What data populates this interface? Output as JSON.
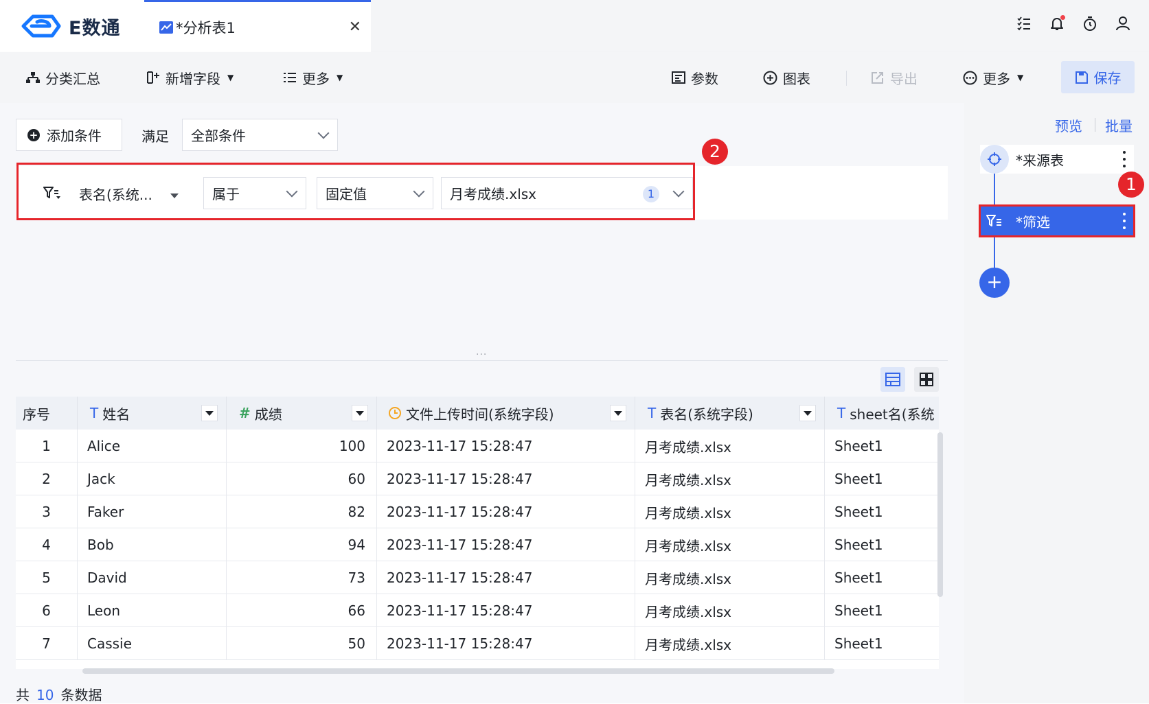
{
  "app": {
    "logo_text": "E数通"
  },
  "tab": {
    "label": "*分析表1",
    "close_glyph": "✕"
  },
  "toolbar": {
    "group_summary": "分类汇总",
    "add_field": "新增字段",
    "more_left": "更多",
    "params": "参数",
    "chart": "图表",
    "export": "导出",
    "more_right": "更多",
    "save": "保存"
  },
  "filter": {
    "add_condition": "添加条件",
    "satisfy_label": "满足",
    "satisfy_value": "全部条件",
    "condition": {
      "field": "表名(系统...",
      "operator": "属于",
      "value_type": "固定值",
      "value": "月考成绩.xlsx",
      "value_count": "1"
    }
  },
  "annotations": {
    "badge_1": "1",
    "badge_2": "2"
  },
  "splitter_dots": "...",
  "table": {
    "columns": [
      {
        "label": "序号",
        "type": "",
        "dropdown": false
      },
      {
        "label": "姓名",
        "type": "T",
        "dropdown": true
      },
      {
        "label": "成绩",
        "type": "#",
        "dropdown": true
      },
      {
        "label": "文件上传时间(系统字段)",
        "type": "clock",
        "dropdown": true
      },
      {
        "label": "表名(系统字段)",
        "type": "T",
        "dropdown": true
      },
      {
        "label": "sheet名(系统",
        "type": "T",
        "dropdown": false
      }
    ],
    "rows": [
      [
        "1",
        "Alice",
        "100",
        "2023-11-17 15:28:47",
        "月考成绩.xlsx",
        "Sheet1"
      ],
      [
        "2",
        "Jack",
        "60",
        "2023-11-17 15:28:47",
        "月考成绩.xlsx",
        "Sheet1"
      ],
      [
        "3",
        "Faker",
        "82",
        "2023-11-17 15:28:47",
        "月考成绩.xlsx",
        "Sheet1"
      ],
      [
        "4",
        "Bob",
        "94",
        "2023-11-17 15:28:47",
        "月考成绩.xlsx",
        "Sheet1"
      ],
      [
        "5",
        "David",
        "73",
        "2023-11-17 15:28:47",
        "月考成绩.xlsx",
        "Sheet1"
      ],
      [
        "6",
        "Leon",
        "66",
        "2023-11-17 15:28:47",
        "月考成绩.xlsx",
        "Sheet1"
      ],
      [
        "7",
        "Cassie",
        "50",
        "2023-11-17 15:28:47",
        "月考成绩.xlsx",
        "Sheet1"
      ]
    ]
  },
  "footer": {
    "prefix": "共",
    "count": "10",
    "suffix": "条数据"
  },
  "pipeline": {
    "preview": "预览",
    "batch": "批量",
    "nodes": [
      {
        "label": "*来源表",
        "icon": "target-icon"
      },
      {
        "label": "*筛选",
        "icon": "filter-icon"
      }
    ],
    "add_glyph": "+"
  },
  "colors": {
    "accent": "#3666e8",
    "highlight": "#e5252b",
    "number_type": "#3aa35e",
    "time_type": "#f5a623"
  }
}
